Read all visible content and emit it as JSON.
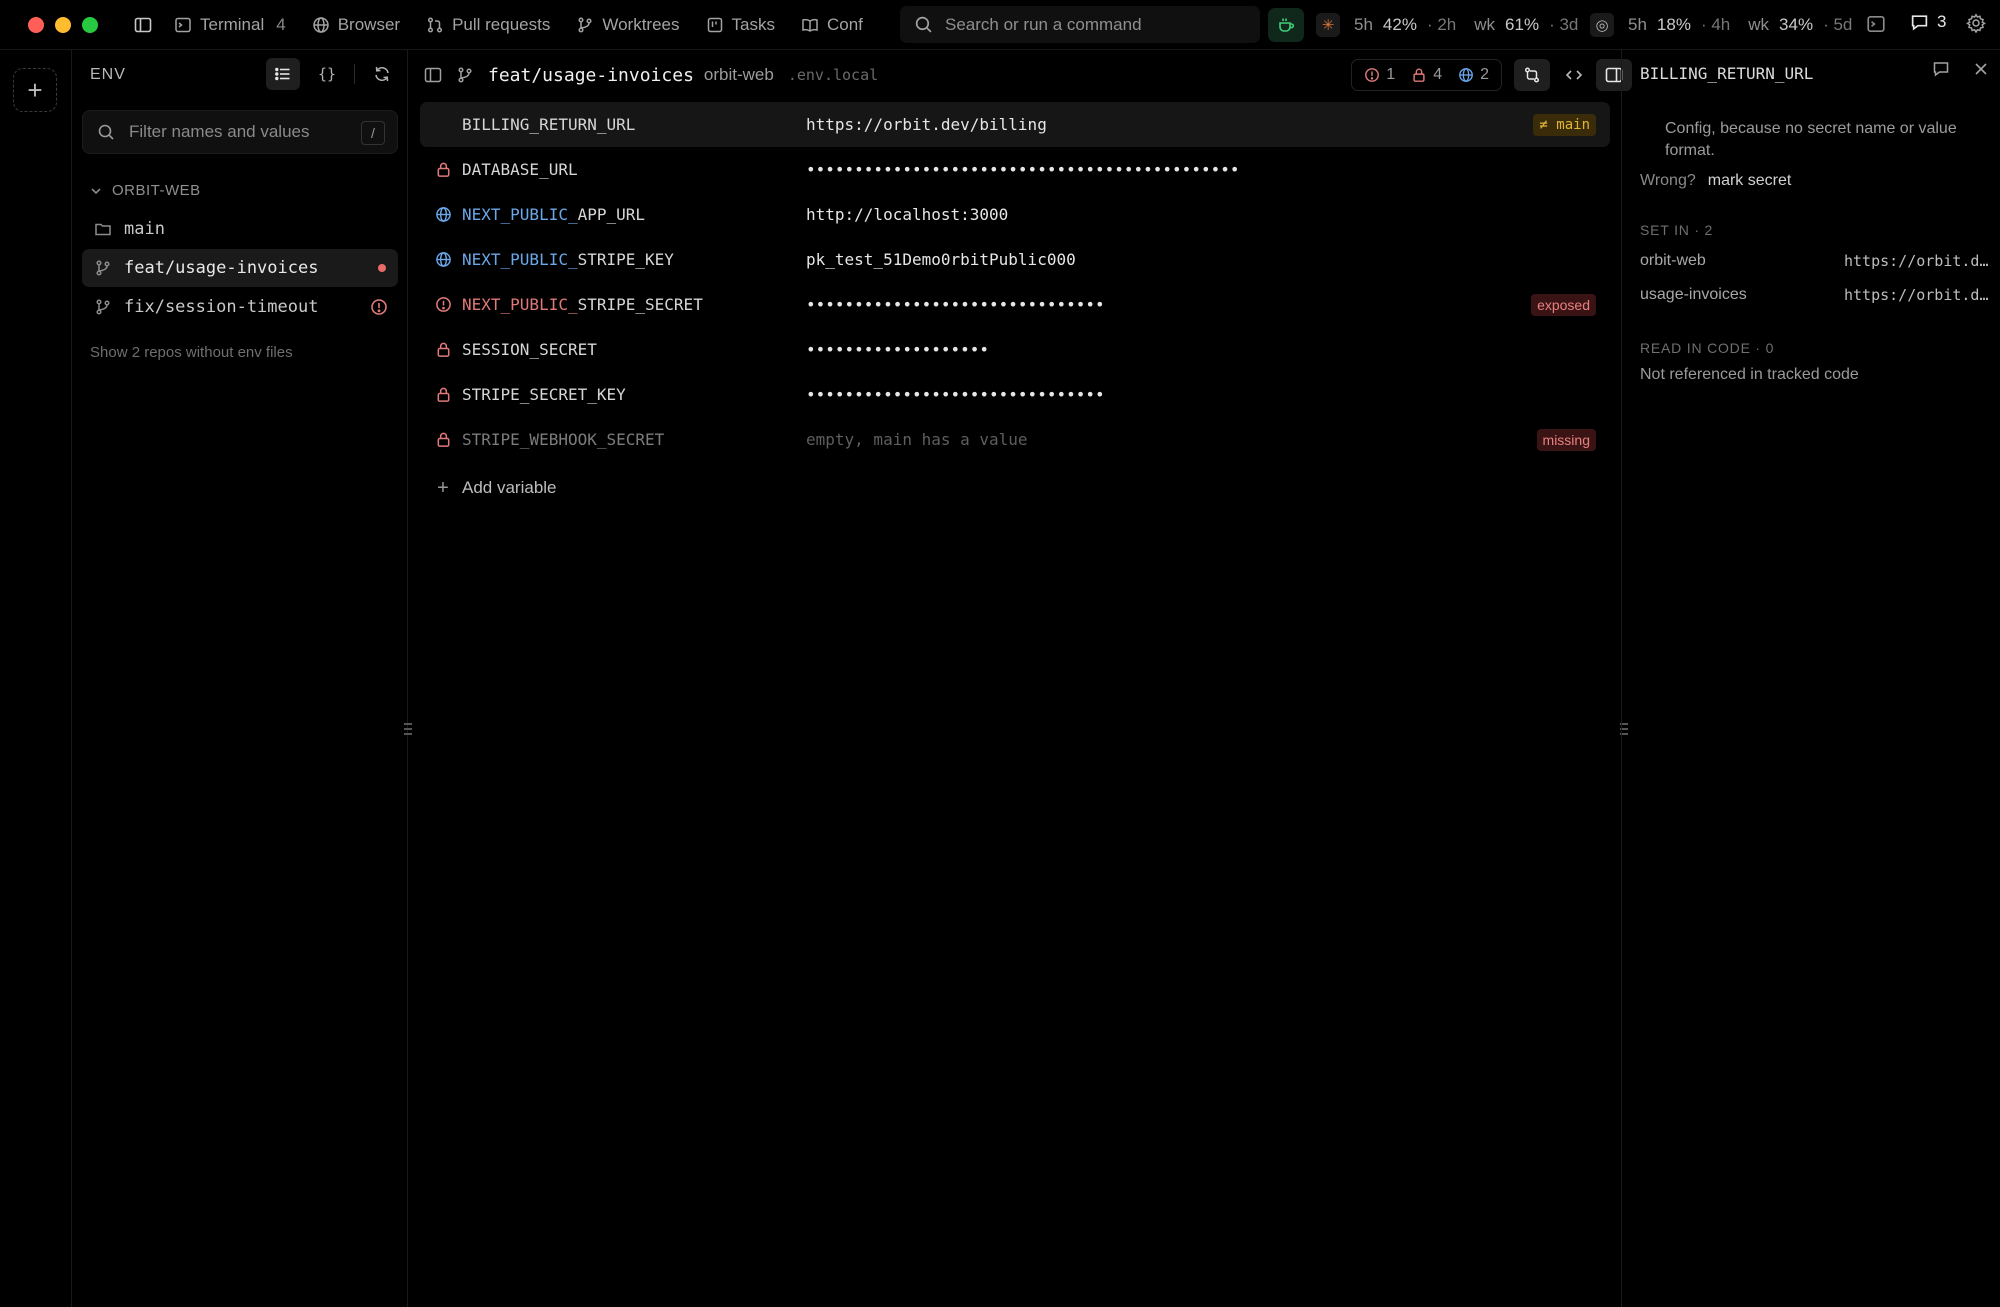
{
  "topbar": {
    "terminal_label": "Terminal",
    "terminal_count": "4",
    "browser_label": "Browser",
    "pull_requests_label": "Pull requests",
    "worktrees_label": "Worktrees",
    "tasks_label": "Tasks",
    "conf_label": "Conf",
    "search_placeholder": "Search or run a command",
    "usage_a": {
      "h_label": "5h",
      "h_pct": "42%",
      "h_left": "· 2h",
      "wk_label": "wk",
      "wk_pct": "61%",
      "wk_left": "· 3d"
    },
    "usage_b": {
      "h_label": "5h",
      "h_pct": "18%",
      "h_left": "· 4h",
      "wk_label": "wk",
      "wk_pct": "34%",
      "wk_left": "· 5d"
    },
    "comments_count": "3"
  },
  "env_panel": {
    "title": "ENV",
    "filter_placeholder": "Filter names and values",
    "filter_shortcut": "/",
    "group_name": "ORBIT-WEB",
    "items": [
      {
        "label": "main",
        "icon": "folder-icon",
        "marker": ""
      },
      {
        "label": "feat/usage-invoices",
        "icon": "branch-icon",
        "marker": "dot"
      },
      {
        "label": "fix/session-timeout",
        "icon": "branch-icon",
        "marker": "alert"
      }
    ],
    "show_more": "Show 2 repos without env files"
  },
  "main": {
    "branch": "feat/usage-invoices",
    "repo": "orbit-web",
    "file": ".env.local",
    "stats": {
      "alerts": "1",
      "secrets": "4",
      "public": "2"
    },
    "variables": [
      {
        "prefix": "",
        "name": "BILLING_RETURN_URL",
        "value": "https://orbit.dev/billing",
        "icon": "none",
        "badge": "≠ main",
        "badge_kind": "diff"
      },
      {
        "prefix": "",
        "name": "DATABASE_URL",
        "value": "•••••••••••••••••••••••••••••••••••••••••••••",
        "icon": "lock-icon",
        "badge": "",
        "badge_kind": ""
      },
      {
        "prefix": "NEXT_PUBLIC_",
        "name": "APP_URL",
        "value": "http://localhost:3000",
        "icon": "globe-icon",
        "badge": "",
        "badge_kind": ""
      },
      {
        "prefix": "NEXT_PUBLIC_",
        "name": "STRIPE_KEY",
        "value": "pk_test_51Demo0rbitPublic000",
        "icon": "globe-icon",
        "badge": "",
        "badge_kind": ""
      },
      {
        "prefix": "NEXT_PUBLIC_",
        "name": "STRIPE_SECRET",
        "value": "•••••••••••••••••••••••••••••••",
        "icon": "alert-icon",
        "badge": "exposed",
        "badge_kind": "danger"
      },
      {
        "prefix": "",
        "name": "SESSION_SECRET",
        "value": "•••••••••••••••••••",
        "icon": "lock-icon",
        "badge": "",
        "badge_kind": ""
      },
      {
        "prefix": "",
        "name": "STRIPE_SECRET_KEY",
        "value": "•••••••••••••••••••••••••••••••",
        "icon": "lock-icon",
        "badge": "",
        "badge_kind": ""
      },
      {
        "prefix": "",
        "name": "STRIPE_WEBHOOK_SECRET",
        "value": "empty, main has a value",
        "icon": "lock-icon",
        "badge": "missing",
        "badge_kind": "danger",
        "muted": true
      }
    ],
    "add_variable": "Add variable"
  },
  "inspector": {
    "title": "BILLING_RETURN_URL",
    "explanation": "Config, because no secret name or value format.",
    "wrong_label": "Wrong?",
    "wrong_action": "mark secret",
    "set_in_heading": "SET IN · 2",
    "set_in": [
      {
        "name": "orbit-web",
        "value": "https://orbit.dev/billing"
      },
      {
        "name": "usage-invoices",
        "value": "https://orbit.dev/billing"
      }
    ],
    "read_in_code_heading": "READ IN CODE · 0",
    "read_in_code_note": "Not referenced in tracked code"
  },
  "colors": {
    "close": "#ff5f57",
    "minimize": "#febc2e",
    "maximize": "#28c840",
    "public_prefix": "#6aa8ea",
    "danger": "#e07a7a",
    "diff_badge": "#e0b53a"
  }
}
